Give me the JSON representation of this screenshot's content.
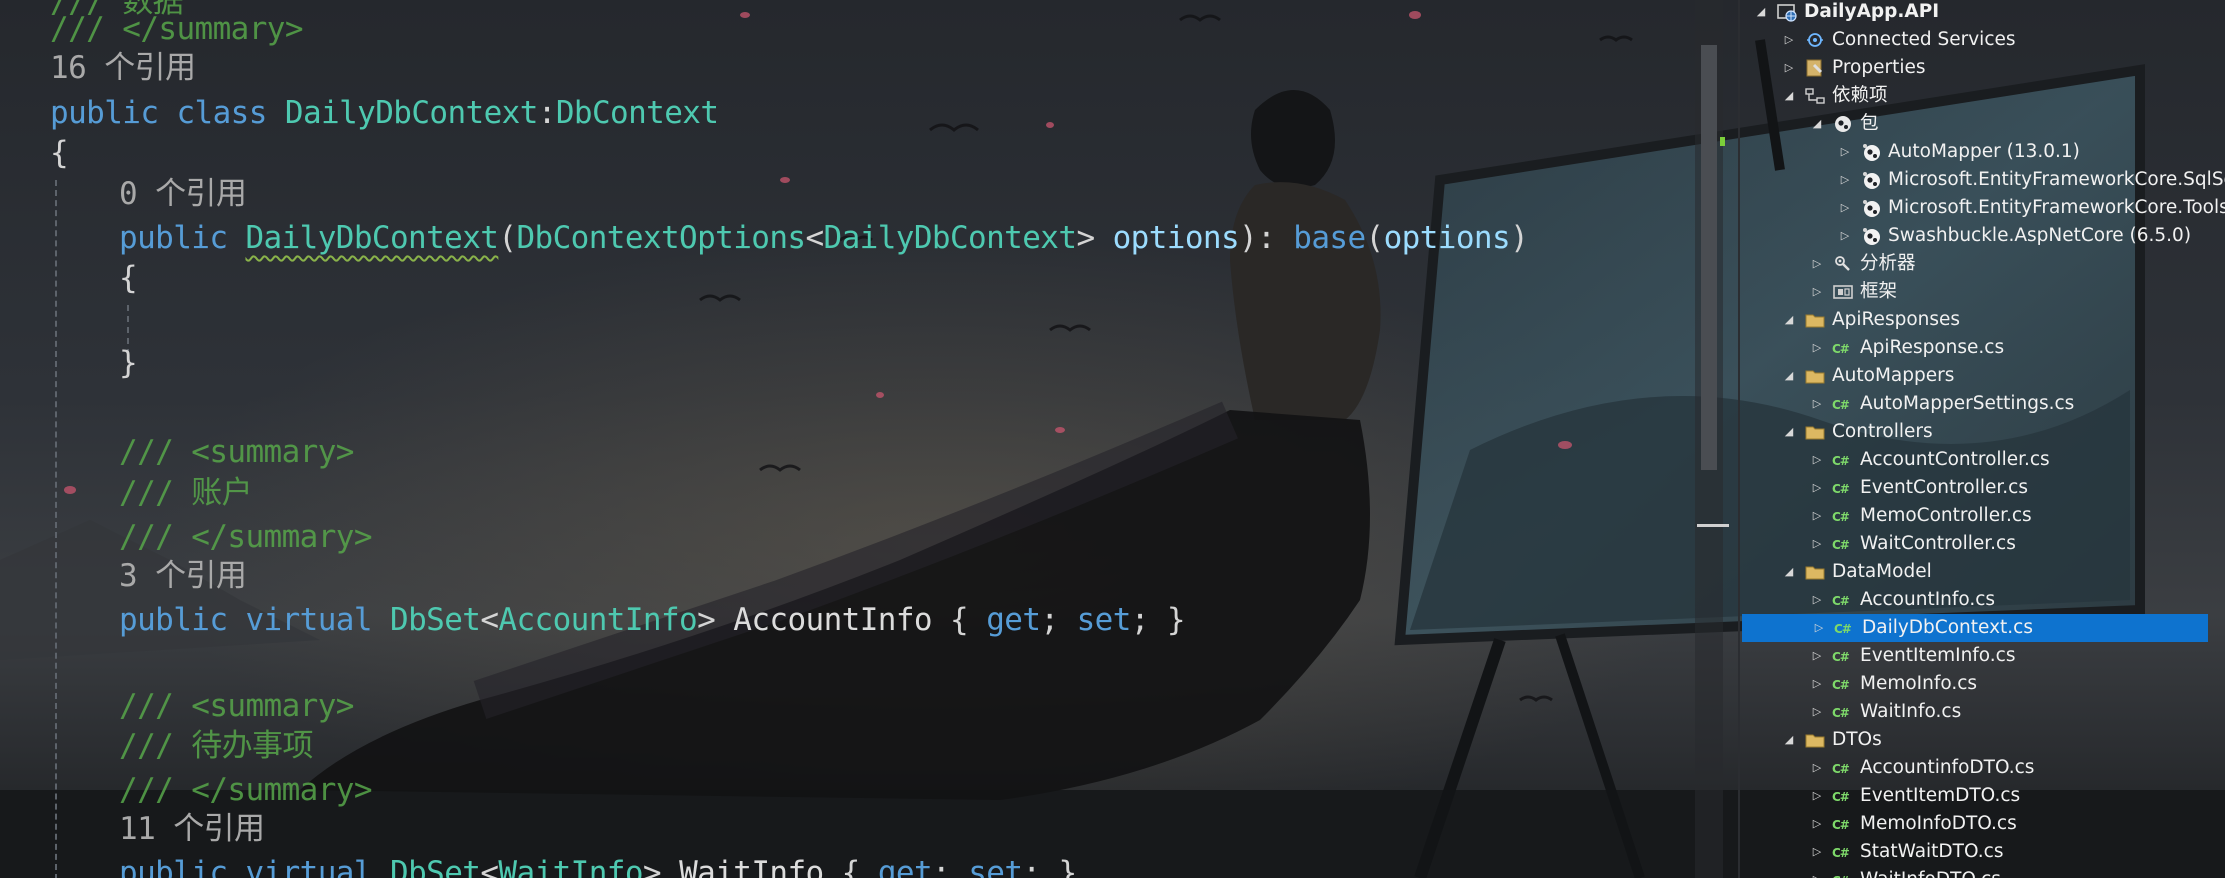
{
  "editor": {
    "lines": [
      {
        "kind": "comment",
        "text": "/// 数据"
      },
      {
        "kind": "comment",
        "text": "/// </summary>"
      },
      {
        "kind": "codelens",
        "text": "16 个引用"
      },
      {
        "kind": "code",
        "tokens": [
          {
            "c": "kw",
            "t": "public"
          },
          {
            "c": "sp",
            "t": " "
          },
          {
            "c": "kw",
            "t": "class"
          },
          {
            "c": "sp",
            "t": " "
          },
          {
            "c": "ty",
            "t": "DailyDbContext"
          },
          {
            "c": "br",
            "t": ":"
          },
          {
            "c": "ty",
            "t": "DbContext"
          }
        ]
      },
      {
        "kind": "code",
        "tokens": [
          {
            "c": "br",
            "t": "{"
          }
        ]
      },
      {
        "kind": "codelens",
        "text": "0 个引用"
      },
      {
        "kind": "code",
        "tokens": [
          {
            "c": "kw",
            "t": "public"
          },
          {
            "c": "sp",
            "t": " "
          },
          {
            "c": "ty squig",
            "t": "DailyDbContext"
          },
          {
            "c": "br",
            "t": "("
          },
          {
            "c": "ty",
            "t": "DbContextOptions"
          },
          {
            "c": "br",
            "t": "<"
          },
          {
            "c": "ty",
            "t": "DailyDbContext"
          },
          {
            "c": "br",
            "t": ">"
          },
          {
            "c": "sp",
            "t": " "
          },
          {
            "c": "pm",
            "t": "options"
          },
          {
            "c": "br",
            "t": "):"
          },
          {
            "c": "sp",
            "t": " "
          },
          {
            "c": "kw",
            "t": "base"
          },
          {
            "c": "br",
            "t": "("
          },
          {
            "c": "pm",
            "t": "options"
          },
          {
            "c": "br",
            "t": ")"
          }
        ]
      },
      {
        "kind": "code",
        "tokens": [
          {
            "c": "br",
            "t": "{"
          }
        ]
      },
      {
        "kind": "code",
        "tokens": [
          {
            "c": "br",
            "t": "}"
          }
        ]
      },
      {
        "kind": "comment",
        "text": "/// <summary>"
      },
      {
        "kind": "comment",
        "text": "/// 账户"
      },
      {
        "kind": "comment",
        "text": "/// </summary>"
      },
      {
        "kind": "codelens",
        "text": "3 个引用"
      },
      {
        "kind": "code",
        "tokens": [
          {
            "c": "kw",
            "t": "public"
          },
          {
            "c": "sp",
            "t": " "
          },
          {
            "c": "kw",
            "t": "virtual"
          },
          {
            "c": "sp",
            "t": " "
          },
          {
            "c": "ty",
            "t": "DbSet"
          },
          {
            "c": "br",
            "t": "<"
          },
          {
            "c": "ty",
            "t": "AccountInfo"
          },
          {
            "c": "br",
            "t": ">"
          },
          {
            "c": "sp",
            "t": " "
          },
          {
            "c": "id",
            "t": "AccountInfo"
          },
          {
            "c": "sp",
            "t": " "
          },
          {
            "c": "br",
            "t": "{"
          },
          {
            "c": "sp",
            "t": " "
          },
          {
            "c": "kw",
            "t": "get"
          },
          {
            "c": "br",
            "t": ";"
          },
          {
            "c": "sp",
            "t": " "
          },
          {
            "c": "kw",
            "t": "set"
          },
          {
            "c": "br",
            "t": ";"
          },
          {
            "c": "sp",
            "t": " "
          },
          {
            "c": "br",
            "t": "}"
          }
        ]
      },
      {
        "kind": "comment",
        "text": "/// <summary>"
      },
      {
        "kind": "comment",
        "text": "/// 待办事项"
      },
      {
        "kind": "comment",
        "text": "/// </summary>"
      },
      {
        "kind": "codelens",
        "text": "11 个引用"
      },
      {
        "kind": "code",
        "tokens": [
          {
            "c": "kw",
            "t": "public"
          },
          {
            "c": "sp",
            "t": " "
          },
          {
            "c": "kw",
            "t": "virtual"
          },
          {
            "c": "sp",
            "t": " "
          },
          {
            "c": "ty",
            "t": "DbSet"
          },
          {
            "c": "br",
            "t": "<"
          },
          {
            "c": "ty",
            "t": "WaitInfo"
          },
          {
            "c": "br",
            "t": ">"
          },
          {
            "c": "sp",
            "t": " "
          },
          {
            "c": "id",
            "t": "WaitInfo"
          },
          {
            "c": "sp",
            "t": " "
          },
          {
            "c": "br",
            "t": "{"
          },
          {
            "c": "sp",
            "t": " "
          },
          {
            "c": "kw",
            "t": "get"
          },
          {
            "c": "br",
            "t": ";"
          },
          {
            "c": "sp",
            "t": " "
          },
          {
            "c": "kw",
            "t": "set"
          },
          {
            "c": "br",
            "t": ";"
          },
          {
            "c": "sp",
            "t": " "
          },
          {
            "c": "br",
            "t": "}"
          }
        ]
      }
    ]
  },
  "explorer": {
    "items": [
      {
        "label": "DailyApp.API",
        "icon": "project-icon",
        "expanded": true,
        "root": true
      },
      {
        "label": "Connected Services",
        "icon": "connected-services-icon",
        "expanded": false
      },
      {
        "label": "Properties",
        "icon": "properties-icon",
        "expanded": false
      },
      {
        "label": "依赖项",
        "icon": "dependencies-icon",
        "expanded": true
      },
      {
        "label": "包",
        "icon": "package-icon",
        "expanded": true
      },
      {
        "label": "AutoMapper (13.0.1)",
        "icon": "nuget-icon",
        "expanded": false
      },
      {
        "label": "Microsoft.EntityFrameworkCore.SqlServer",
        "icon": "nuget-icon",
        "expanded": false
      },
      {
        "label": "Microsoft.EntityFrameworkCore.Tools",
        "icon": "nuget-icon",
        "expanded": false
      },
      {
        "label": "Swashbuckle.AspNetCore (6.5.0)",
        "icon": "nuget-icon",
        "expanded": false
      },
      {
        "label": "分析器",
        "icon": "analyzer-icon",
        "expanded": false
      },
      {
        "label": "框架",
        "icon": "framework-icon",
        "expanded": false
      },
      {
        "label": "ApiResponses",
        "icon": "folder-icon",
        "expanded": true
      },
      {
        "label": "ApiResponse.cs",
        "icon": "csharp-file-icon",
        "expanded": false
      },
      {
        "label": "AutoMappers",
        "icon": "folder-icon",
        "expanded": true
      },
      {
        "label": "AutoMapperSettings.cs",
        "icon": "csharp-file-icon",
        "expanded": false
      },
      {
        "label": "Controllers",
        "icon": "folder-icon",
        "expanded": true
      },
      {
        "label": "AccountController.cs",
        "icon": "csharp-file-icon",
        "expanded": false
      },
      {
        "label": "EventController.cs",
        "icon": "csharp-file-icon",
        "expanded": false
      },
      {
        "label": "MemoController.cs",
        "icon": "csharp-file-icon",
        "expanded": false
      },
      {
        "label": "WaitController.cs",
        "icon": "csharp-file-icon",
        "expanded": false
      },
      {
        "label": "DataModel",
        "icon": "folder-icon",
        "expanded": true
      },
      {
        "label": "AccountInfo.cs",
        "icon": "csharp-file-icon",
        "expanded": false
      },
      {
        "label": "DailyDbContext.cs",
        "icon": "csharp-file-icon",
        "expanded": false,
        "selected": true
      },
      {
        "label": "EventItemInfo.cs",
        "icon": "csharp-file-icon",
        "expanded": false
      },
      {
        "label": "MemoInfo.cs",
        "icon": "csharp-file-icon",
        "expanded": false
      },
      {
        "label": "WaitInfo.cs",
        "icon": "csharp-file-icon",
        "expanded": false
      },
      {
        "label": "DTOs",
        "icon": "folder-icon",
        "expanded": true
      },
      {
        "label": "AccountinfoDTO.cs",
        "icon": "csharp-file-icon",
        "expanded": false
      },
      {
        "label": "EventItemDTO.cs",
        "icon": "csharp-file-icon",
        "expanded": false
      },
      {
        "label": "MemoInfoDTO.cs",
        "icon": "csharp-file-icon",
        "expanded": false
      },
      {
        "label": "StatWaitDTO.cs",
        "icon": "csharp-file-icon",
        "expanded": false
      },
      {
        "label": "WaitInfoDTO.cs",
        "icon": "csharp-file-icon",
        "expanded": false
      }
    ]
  },
  "colors": {
    "keyword": "#569cd6",
    "type": "#4ec9b0",
    "comment": "#57a64a",
    "codelens": "#a9a9a9",
    "parameter": "#9cdcfe",
    "selection": "#0e73cf",
    "csharp_icon": "#7ed96a"
  }
}
